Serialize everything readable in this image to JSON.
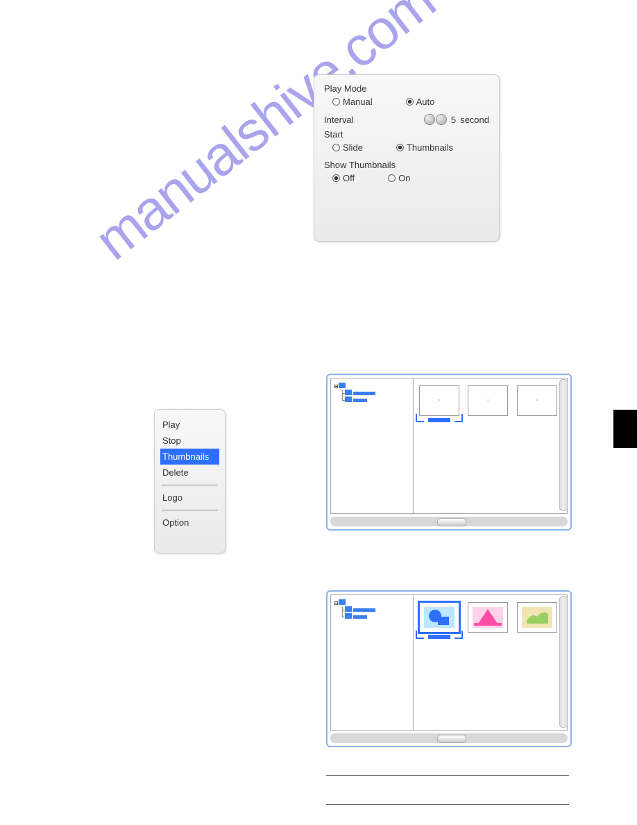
{
  "options": {
    "play_mode_label": "Play Mode",
    "manual": "Manual",
    "auto": "Auto",
    "interval_label": "Interval",
    "interval_value": "5",
    "interval_unit": "second",
    "start_label": "Start",
    "slide": "Slide",
    "thumbnails": "Thumbnails",
    "show_thumbnails_label": "Show Thumbnails",
    "off": "Off",
    "on": "On"
  },
  "context": {
    "items": {
      "play": "Play",
      "stop": "Stop",
      "thumbnails": "Thumbnails",
      "delete": "Delete",
      "logo": "Logo",
      "option": "Option"
    }
  },
  "watermark": "manualshive.com"
}
